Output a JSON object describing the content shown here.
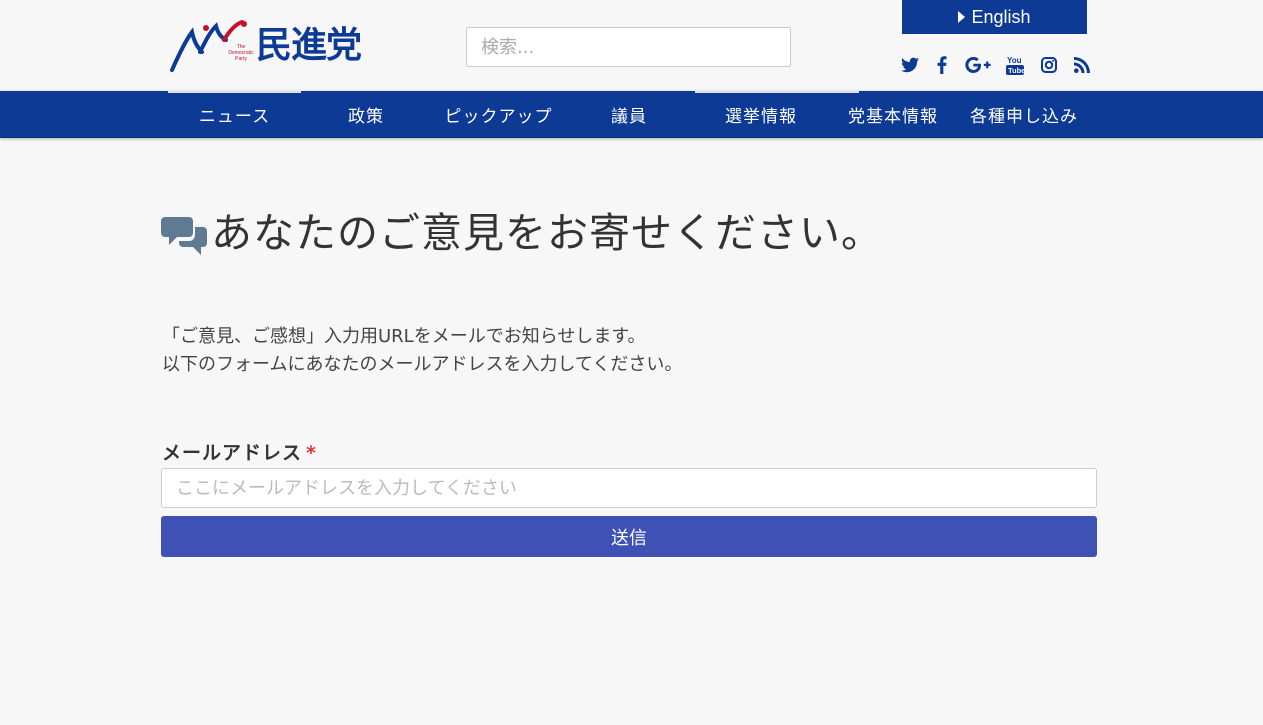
{
  "header": {
    "logo_text": "民進党",
    "logo_sub": "The Democratic Party",
    "search_placeholder": "検索...",
    "lang_button": "English",
    "social_icons": [
      "twitter-icon",
      "facebook-icon",
      "google-plus-icon",
      "youtube-icon",
      "instagram-icon",
      "rss-icon"
    ]
  },
  "nav": {
    "items": [
      "ニュース",
      "政策",
      "ピックアップ",
      "議員",
      "選挙情報",
      "党基本情報",
      "各種申し込み"
    ]
  },
  "main": {
    "title": "あなたのご意見をお寄せください。",
    "desc_line1": "「ご意見、ご感想」入力用URLをメールでお知らせします。",
    "desc_line2": "以下のフォームにあなたのメールアドレスを入力してください。",
    "email_label": "メールアドレス",
    "required_mark": "*",
    "email_placeholder": "ここにメールアドレスを入力してください",
    "submit_label": "送信"
  },
  "colors": {
    "brand_blue": "#0c3a95",
    "submit": "#3f51b5",
    "required": "#dd3333",
    "logo_red": "#c8102e"
  }
}
